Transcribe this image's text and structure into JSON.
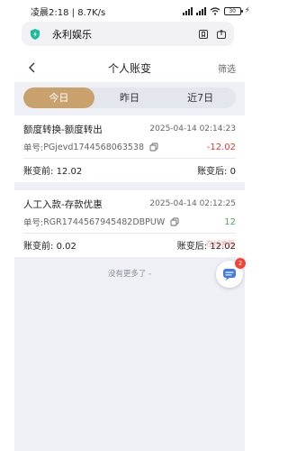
{
  "status_bar": {
    "time": "凌晨2:18",
    "network": "8.7K/s",
    "battery": "30"
  },
  "browser": {
    "title": "永利娱乐"
  },
  "header": {
    "title": "个人账变",
    "filter": "筛选"
  },
  "tabs": [
    {
      "label": "今日",
      "active": true
    },
    {
      "label": "昨日",
      "active": false
    },
    {
      "label": "近7日",
      "active": false
    }
  ],
  "transactions": [
    {
      "title": "额度转换-额度转出",
      "time": "2025-04-14 02:14:23",
      "order_label": "单号:",
      "order_no": "PGjevd1744568063538",
      "amount": "-12.02",
      "before_label": "账变前:",
      "before": "12.02",
      "after_label": "账变后:",
      "after": "0"
    },
    {
      "title": "人工入款-存款优惠",
      "time": "2025-04-14 02:12:25",
      "order_label": "单号:",
      "order_no": "RGR1744567945482DBPUW",
      "amount": "12",
      "before_label": "账变前:",
      "before": "0.02",
      "after_label": "账变后:",
      "after": "12.02"
    }
  ],
  "footer": {
    "no_more": "没有更多了 -"
  },
  "support": {
    "label": "在线客服",
    "badge": "2"
  },
  "colors": {
    "accent": "#c8a16d",
    "negative": "#e53935",
    "positive": "#4caf50"
  }
}
